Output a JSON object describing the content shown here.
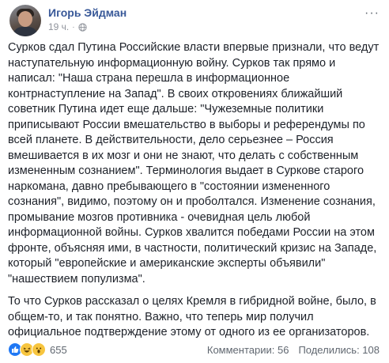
{
  "post": {
    "author": "Игорь Эйдман",
    "time": "19 ч.",
    "dot": "·",
    "more": "···",
    "paragraphs": [
      "Сурков сдал Путина Российские власти впервые признали, что ведут наступательную информационную войну. Сурков так прямо и написал: \"Наша страна перешла в информационное контрнаступление на Запад\". В своих откровениях ближайший советник Путина идет еще дальше: \"Чужеземные политики приписывают России вмешательство в выборы и референдумы по всей планете. В действительности, дело серьезнее – Россия вмешивается в их мозг и они не знают, что делать с собственным измененным сознанием\". Терминология выдает в Суркове старого наркомана, давно пребывающего в \"состоянии измененного сознания\", видимо, поэтому он и проболтался. Изменение сознания, промывание мозгов противника - очевидная цель любой информационной войны. Сурков хвалится победами России на этом фронте, объясняя ими, в частности, политический кризис на Западе, который \"европейские и американские эксперты объявили\" \"нашествием популизма\".",
      "То что Сурков рассказал о целях Кремля в гибридной войне, было, в общем-то, и так понятно. Важно, что теперь мир получил официальное подтверждение этому от одного из ее организаторов."
    ]
  },
  "footer": {
    "reactions": [
      "like-icon",
      "haha-icon",
      "wow-icon"
    ],
    "reaction_count": "655",
    "comments": "Комментарии: 56",
    "shares": "Поделились: 108"
  },
  "colors": {
    "author": "#385898",
    "meta": "#90949c",
    "like": "#2078f4",
    "emoji": "#f7c53f"
  }
}
